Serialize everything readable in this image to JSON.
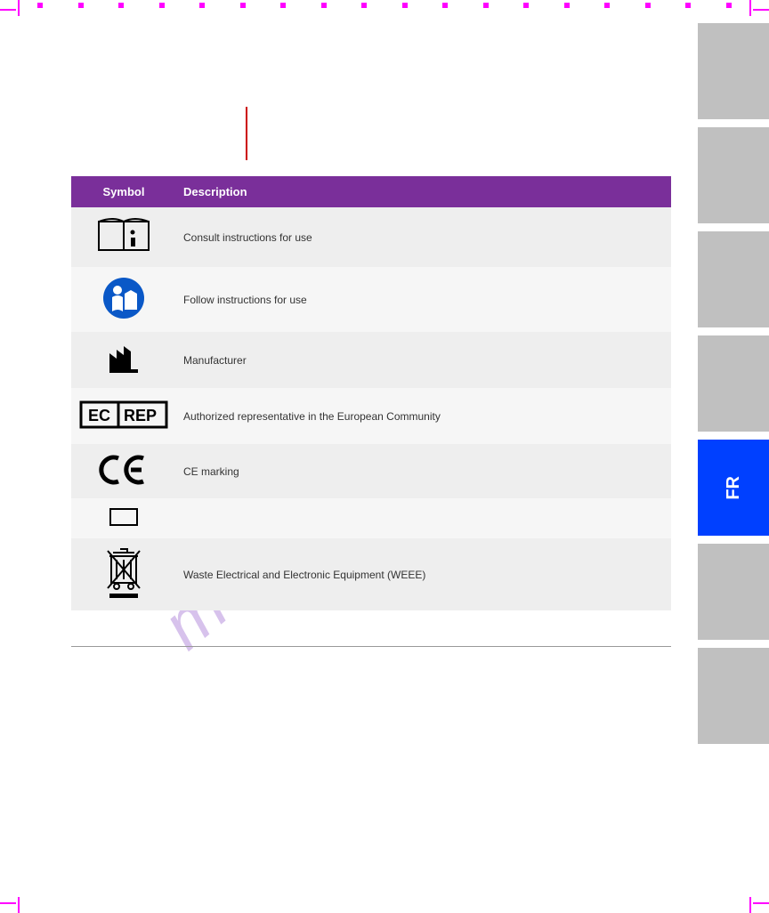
{
  "watermark": "manualshive.com",
  "header_red_note": "",
  "intro_paragraphs": [
    "",
    ""
  ],
  "contact_section": {
    "heading": "",
    "body": ""
  },
  "table": {
    "caption": "",
    "headers": {
      "symbol": "Symbol",
      "description": "Description"
    },
    "rows": [
      {
        "icon": "manual-icon",
        "desc": "Consult instructions for use"
      },
      {
        "icon": "read-manual-icon",
        "desc": "Follow instructions for use"
      },
      {
        "icon": "manufacturer-icon",
        "desc": "Manufacturer"
      },
      {
        "icon": "ec-rep-icon",
        "desc": "Authorized representative in the European Community"
      },
      {
        "icon": "ce-mark-icon",
        "desc": "CE marking"
      },
      {
        "icon": "rectangle-icon",
        "desc": ""
      },
      {
        "icon": "weee-icon",
        "desc": "Waste Electrical and Electronic Equipment (WEEE)"
      }
    ]
  },
  "sidebar_tabs": [
    {
      "label": "",
      "active": false
    },
    {
      "label": "",
      "active": false
    },
    {
      "label": "",
      "active": false
    },
    {
      "label": "",
      "active": false
    },
    {
      "label": "FR",
      "active": true
    },
    {
      "label": "",
      "active": false
    },
    {
      "label": "",
      "active": false
    }
  ],
  "footer": {
    "left": "",
    "right": ""
  },
  "colors": {
    "accent": "#7a2f9a",
    "active_tab": "#0040ff",
    "crop": "#ff00ff"
  }
}
